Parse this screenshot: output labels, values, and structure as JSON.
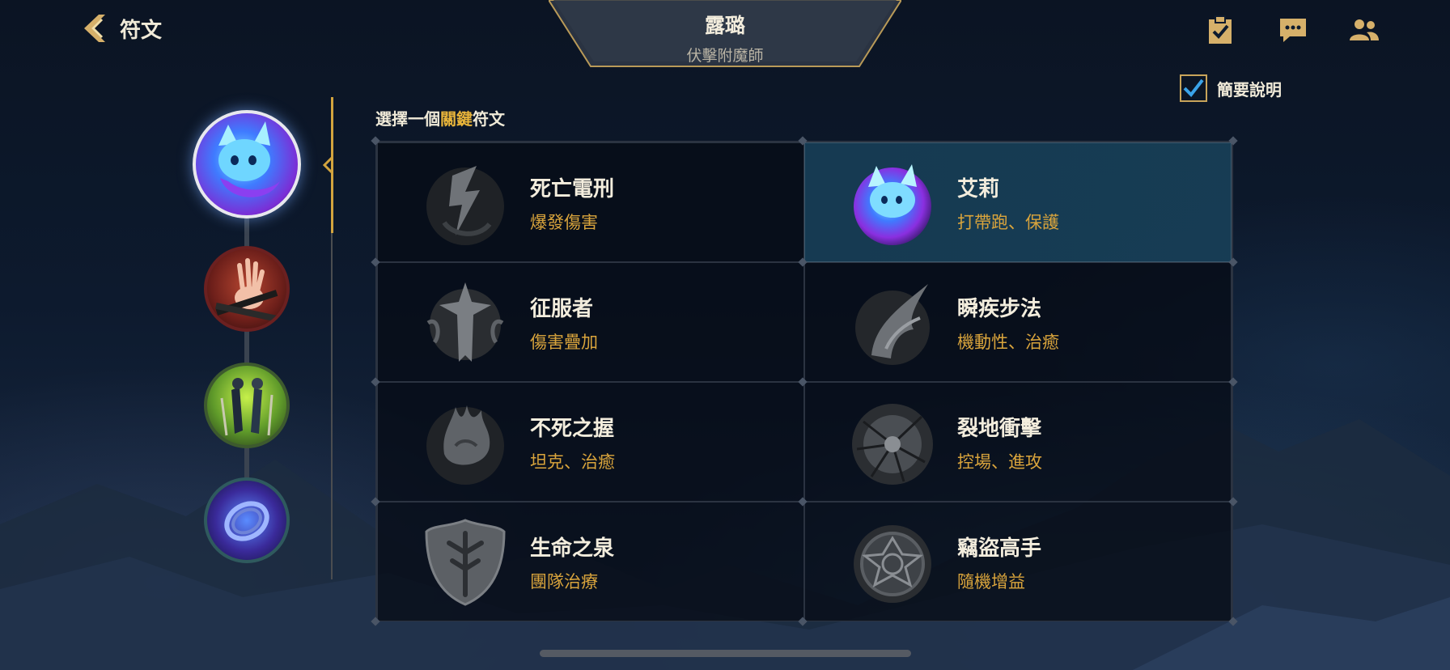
{
  "header": {
    "back_label": "符文",
    "champion_name": "露璐",
    "champion_role": "伏擊附魔師"
  },
  "top_icons": [
    "quest-clipboard-icon",
    "chat-icon",
    "friends-icon"
  ],
  "summary_toggle": {
    "label": "簡要說明",
    "checked": true
  },
  "prompt": {
    "pre": "選擇一個",
    "highlight": "關鍵",
    "post": "符文"
  },
  "runes": [
    {
      "name": "死亡電刑",
      "desc": "爆發傷害",
      "icon": "electrocute-icon"
    },
    {
      "name": "艾莉",
      "desc": "打帶跑、保護",
      "icon": "aery-icon",
      "selected": true
    },
    {
      "name": "征服者",
      "desc": "傷害疊加",
      "icon": "conqueror-icon"
    },
    {
      "name": "瞬疾步法",
      "desc": "機動性、治癒",
      "icon": "fleet-footwork-icon"
    },
    {
      "name": "不死之握",
      "desc": "坦克、治癒",
      "icon": "grasp-icon"
    },
    {
      "name": "裂地衝擊",
      "desc": "控場、進攻",
      "icon": "aftershock-icon"
    },
    {
      "name": "生命之泉",
      "desc": "團隊治療",
      "icon": "font-of-life-icon"
    },
    {
      "name": "竊盜高手",
      "desc": "隨機增益",
      "icon": "kleptomancy-icon"
    }
  ],
  "path_nodes": [
    "aery-icon",
    "domination-icon",
    "precision-icon",
    "inspiration-icon"
  ],
  "colors": {
    "accent": "#d9a43c",
    "selected_bg": "#163c54",
    "gold_border": "#c8a45a"
  }
}
